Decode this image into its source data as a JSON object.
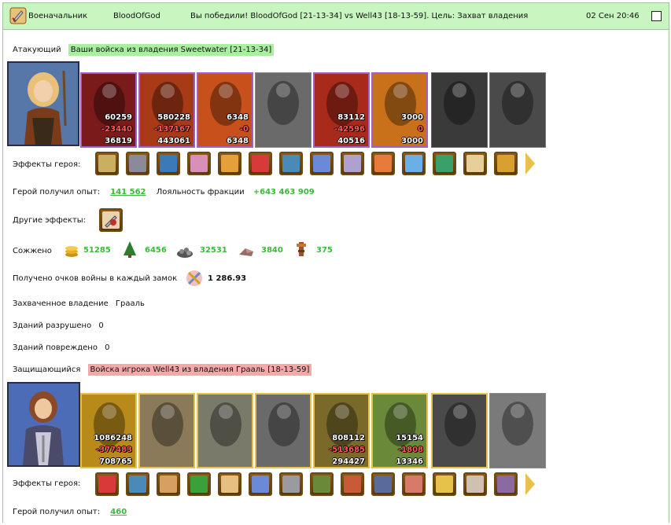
{
  "header": {
    "role": "Военачальник",
    "player": "BloodOfGod",
    "message": "Вы победили! BloodOfGod [21-13-34] vs Well43 [18-13-59]. Цель: Захват владения",
    "datetime": "02 Сен 20:46"
  },
  "attacker": {
    "label": "Атакующий",
    "desc": "Ваши войска из владения Sweetwater [21-13-34]",
    "units": [
      {
        "n1": "60259",
        "n2": "-23440",
        "n3": "36819"
      },
      {
        "n1": "580228",
        "n2": "-137167",
        "n3": "443061"
      },
      {
        "n1": "6348",
        "n2": "-0",
        "n3": "6348"
      },
      {
        "n1": "",
        "n2": "",
        "n3": ""
      },
      {
        "n1": "83112",
        "n2": "-42596",
        "n3": "40516"
      },
      {
        "n1": "3000",
        "n2": "0",
        "n3": "3000"
      },
      {
        "n1": "",
        "n2": "",
        "n3": ""
      },
      {
        "n1": "",
        "n2": "",
        "n3": ""
      }
    ],
    "effects_label": "Эффекты героя:",
    "exp_label": "Герой получил опыт:",
    "exp_value": "141 562",
    "loyalty_label": "Лояльность фракции",
    "loyalty_value": "+643 463 909",
    "other_effects_label": "Другие эффекты:",
    "burned_label": "Сожжено",
    "burned": [
      "51285",
      "6456",
      "32531",
      "3840",
      "375"
    ],
    "war_points_label": "Получено очков войны в каждый замок",
    "war_points_value": "1 286.93",
    "captured_label": "Захваченное владение",
    "captured_value": "Грааль",
    "destroyed_label": "Зданий разрушено",
    "destroyed_value": "0",
    "damaged_label": "Зданий повреждено",
    "damaged_value": "0"
  },
  "defender": {
    "label": "Защищающийся",
    "desc": "Войска игрока Well43 из владения Грааль [18-13-59]",
    "units": [
      {
        "n1": "1086248",
        "n2": "-377483",
        "n3": "708765"
      },
      {
        "n1": "",
        "n2": "",
        "n3": ""
      },
      {
        "n1": "",
        "n2": "",
        "n3": ""
      },
      {
        "n1": "",
        "n2": "",
        "n3": ""
      },
      {
        "n1": "808112",
        "n2": "-513685",
        "n3": "294427"
      },
      {
        "n1": "15154",
        "n2": "-1808",
        "n3": "13346"
      },
      {
        "n1": "",
        "n2": "",
        "n3": ""
      },
      {
        "n1": "",
        "n2": "",
        "n3": ""
      }
    ],
    "effects_label": "Эффекты героя:",
    "exp_label": "Герой получил опыт:",
    "exp_value": "460"
  },
  "colors": {
    "header_bg": "#c8f5c0",
    "attacker_badge": "#a8f0a0",
    "defender_badge": "#f6a8a8",
    "value_green": "#3cb83c",
    "loss_red": "#ff5c5c"
  }
}
